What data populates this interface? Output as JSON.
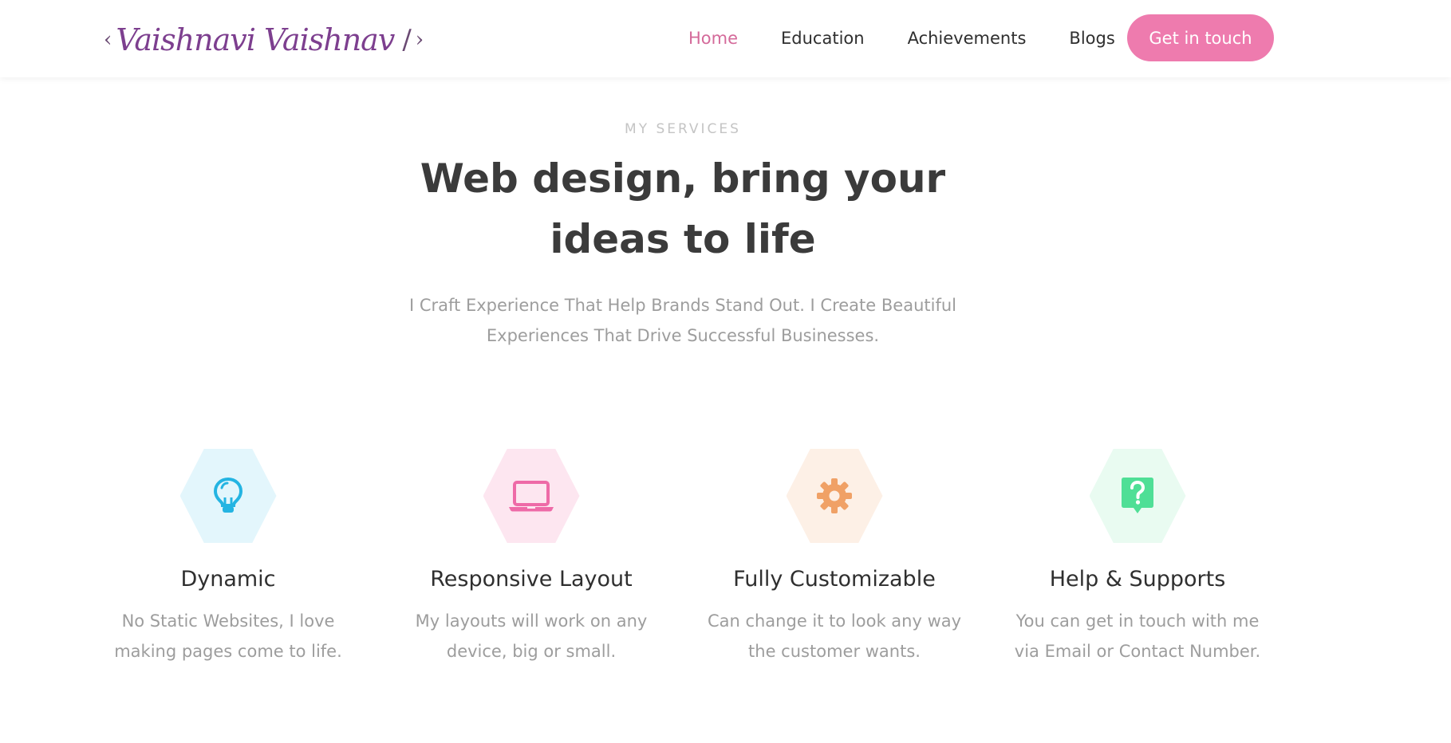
{
  "brand": {
    "left_angle": "‹",
    "name": "Vaishnavi Vaishnav",
    "slash": "/",
    "right_angle": "›"
  },
  "nav": {
    "items": [
      {
        "label": "Home",
        "active": true
      },
      {
        "label": "Education",
        "active": false
      },
      {
        "label": "Achievements",
        "active": false
      },
      {
        "label": "Blogs",
        "active": false
      }
    ],
    "cta_label": "Get in touch"
  },
  "hero": {
    "label": "MY SERVICES",
    "title_line1": "Web design, bring your",
    "title_line2": "ideas to life",
    "subtitle_line1": "I Craft Experience That Help Brands Stand Out. I Create Beautiful",
    "subtitle_line2": "Experiences That Drive Successful Businesses."
  },
  "services": [
    {
      "icon": "lightbulb-icon",
      "title": "Dynamic",
      "desc_line1": "No Static Websites, I love",
      "desc_line2": "making pages come to life.",
      "color": "#24b4e2",
      "bg": "#e3f6fc"
    },
    {
      "icon": "laptop-icon",
      "title": "Responsive Layout",
      "desc_line1": "My layouts will work on any",
      "desc_line2": "device, big or small.",
      "color": "#ee6aa7",
      "bg": "#fde6f0"
    },
    {
      "icon": "gear-icon",
      "title": "Fully Customizable",
      "desc_line1": "Can change it to look any way",
      "desc_line2": "the customer wants.",
      "color": "#f0a166",
      "bg": "#fdf0e6"
    },
    {
      "icon": "help-icon",
      "title": "Help & Supports",
      "desc_line1": "You can get in touch with me",
      "desc_line2": "via Email or Contact Number.",
      "color": "#4fdf96",
      "bg": "#e9fbf1"
    }
  ]
}
